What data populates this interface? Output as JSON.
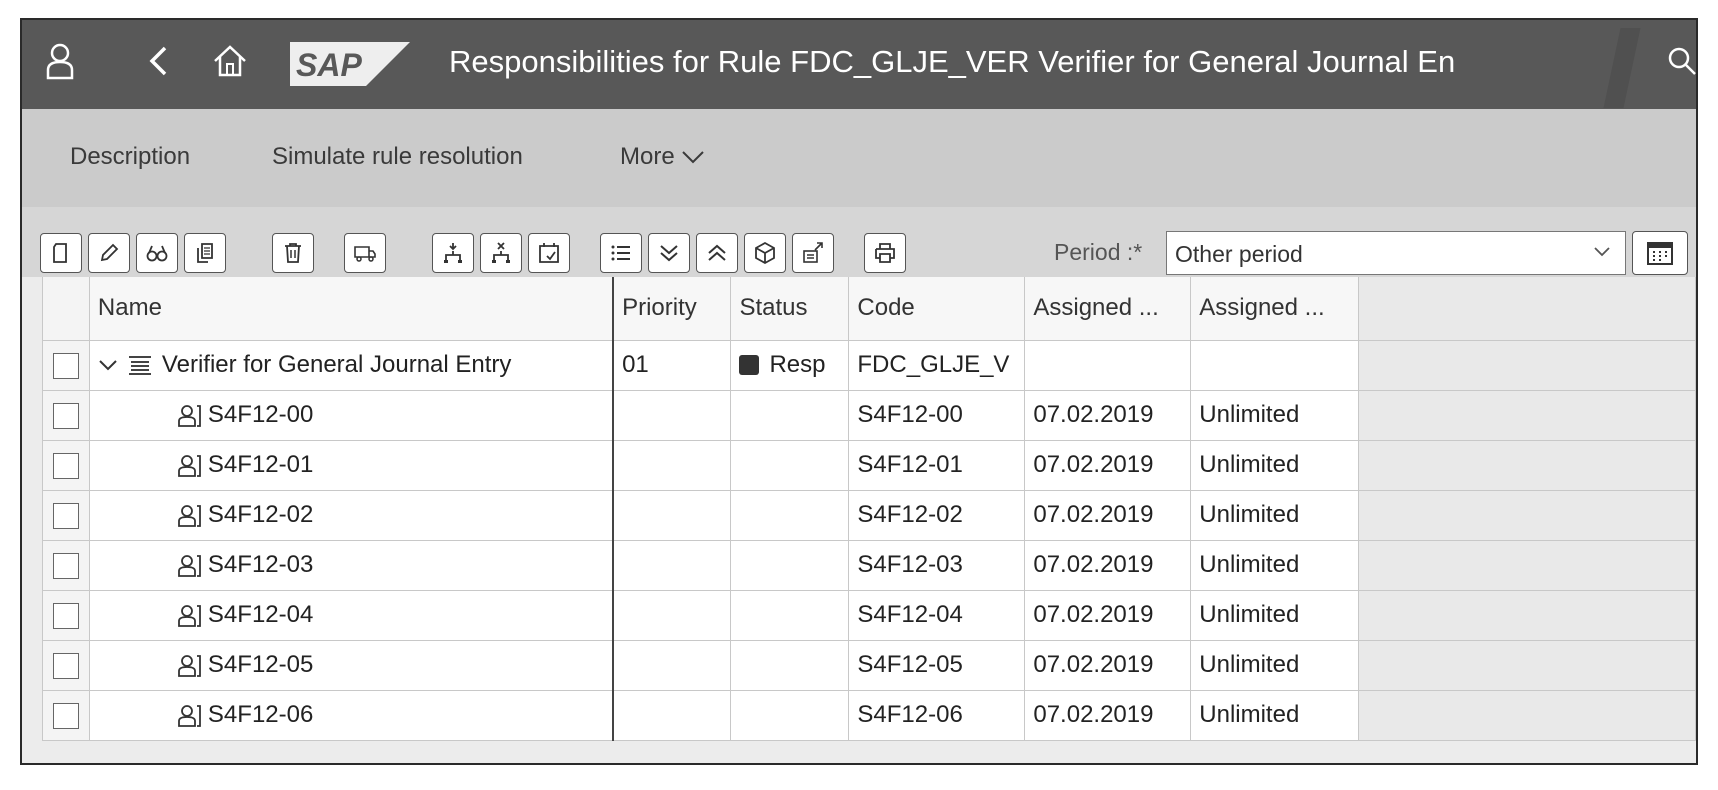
{
  "shell": {
    "logo_text": "SAP",
    "title": "Responsibilities for Rule FDC_GLJE_VER Verifier for General Journal En",
    "icons": [
      "user-icon",
      "back-icon",
      "home-icon",
      "search-icon"
    ],
    "grip": "....."
  },
  "menu": {
    "description": "Description",
    "simulate": "Simulate rule resolution",
    "more": "More"
  },
  "toolbar": {
    "period_label": "Period :*",
    "period_value": "Other period",
    "buttons": [
      "new-icon",
      "edit-icon",
      "display-icon",
      "copy-icon",
      "delete-icon",
      "transport-icon",
      "hierarchy-down-icon",
      "hierarchy-up-icon",
      "calendar-check-icon",
      "list-icon",
      "expand-all-icon",
      "collapse-all-icon",
      "package-icon",
      "export-icon",
      "print-icon",
      "calendar-icon"
    ]
  },
  "table": {
    "headers": {
      "name": "Name",
      "priority": "Priority",
      "status": "Status",
      "code": "Code",
      "assigned_from": "Assigned ...",
      "assigned_to": "Assigned ..."
    },
    "parent": {
      "name": "Verifier for General Journal Entry",
      "priority": "01",
      "status": "Resp",
      "code": "FDC_GLJE_V",
      "assigned_from": "",
      "assigned_to": ""
    },
    "rows": [
      {
        "name": "S4F12-00",
        "code": "S4F12-00",
        "from": "07.02.2019",
        "to": "Unlimited"
      },
      {
        "name": "S4F12-01",
        "code": "S4F12-01",
        "from": "07.02.2019",
        "to": "Unlimited"
      },
      {
        "name": "S4F12-02",
        "code": "S4F12-02",
        "from": "07.02.2019",
        "to": "Unlimited"
      },
      {
        "name": "S4F12-03",
        "code": "S4F12-03",
        "from": "07.02.2019",
        "to": "Unlimited"
      },
      {
        "name": "S4F12-04",
        "code": "S4F12-04",
        "from": "07.02.2019",
        "to": "Unlimited"
      },
      {
        "name": "S4F12-05",
        "code": "S4F12-05",
        "from": "07.02.2019",
        "to": "Unlimited"
      },
      {
        "name": "S4F12-06",
        "code": "S4F12-06",
        "from": "07.02.2019",
        "to": "Unlimited"
      }
    ]
  },
  "colors": {
    "shell_bg": "#585858",
    "menubar_bg": "#cbcbcb",
    "toolbar_bg": "#d6d6d6",
    "status_marker": "#333333"
  }
}
